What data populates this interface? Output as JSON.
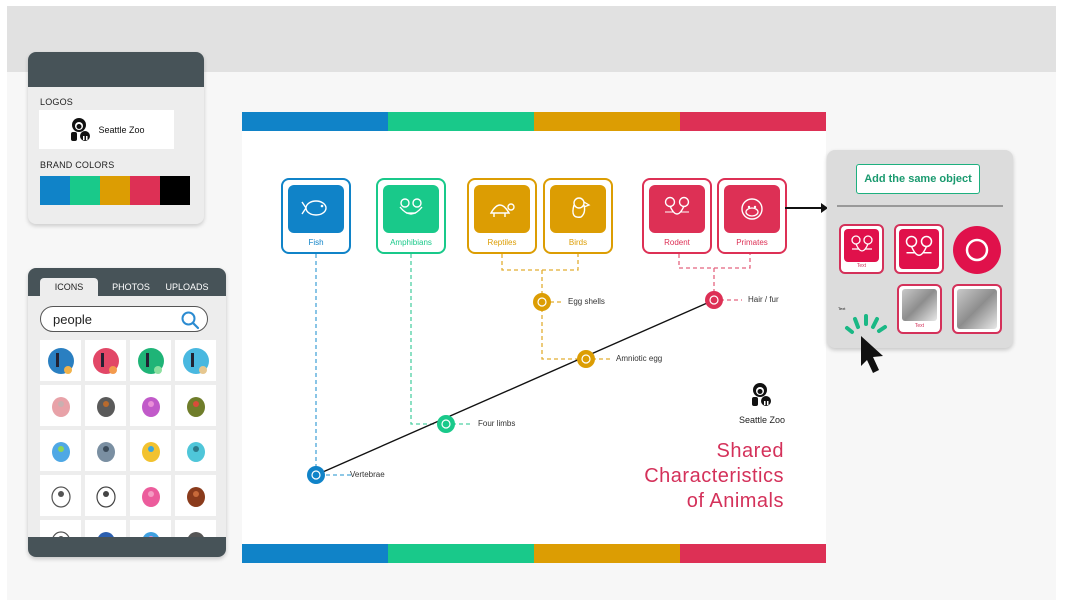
{
  "brand_panel": {
    "logos_label": "LOGOS",
    "logo_name": "Seattle Zoo",
    "brand_colors_label": "BRAND COLORS",
    "colors": [
      "#1083c8",
      "#19c98a",
      "#dc9d03",
      "#dd3055",
      "#000000"
    ]
  },
  "assets_panel": {
    "tabs": [
      {
        "label": "ICONS",
        "active": true
      },
      {
        "label": "PHOTOS",
        "active": false
      },
      {
        "label": "UPLOADS",
        "active": false
      }
    ],
    "search_value": "people",
    "icons": [
      "person-walking-dog-blue",
      "person-walking-dog-red",
      "person-walking-dog-green",
      "person-walking-dog-teal",
      "koala-pink",
      "koala-gray",
      "bunny-purple",
      "dinosaur-green",
      "easter-egg-blue",
      "horse-gray",
      "birdhouse-yellow",
      "person-couch",
      "easter-egg-outline",
      "bunny-outline",
      "bunny-pink",
      "dog-lying-brown",
      "bunny-ears-outline",
      "blue-shape",
      "blue-bird",
      "music-note"
    ]
  },
  "canvas": {
    "stripe_colors": [
      "#1083c8",
      "#19c98a",
      "#dc9d03",
      "#dd3055"
    ],
    "groups": [
      {
        "label": "Fish",
        "icon": "fish-icon",
        "color": "#1083c8"
      },
      {
        "label": "Amphibians",
        "icon": "frog-icon",
        "color": "#19c98a"
      },
      {
        "label": "Reptiles",
        "icon": "turtle-icon",
        "color": "#dc9d03"
      },
      {
        "label": "Birds",
        "icon": "bird-icon",
        "color": "#dc9d03"
      },
      {
        "label": "Rodent",
        "icon": "rodent-icon",
        "color": "#dd3055"
      },
      {
        "label": "Primates",
        "icon": "monkey-icon",
        "color": "#dd3055"
      }
    ],
    "traits": [
      {
        "label": "Vertebrae",
        "color": "#1083c8"
      },
      {
        "label": "Four limbs",
        "color": "#19c98a"
      },
      {
        "label": "Amniotic egg",
        "color": "#dc9d03"
      },
      {
        "label": "Egg shells",
        "color": "#dc9d03"
      },
      {
        "label": "Hair / fur",
        "color": "#dd3055"
      }
    ],
    "logo_name": "Seattle Zoo",
    "title_lines": [
      "Shared",
      "Characteristics",
      "of Animals"
    ]
  },
  "object_panel": {
    "add_button": "Add the same object",
    "item_text": "Text",
    "small_text": "Text"
  }
}
